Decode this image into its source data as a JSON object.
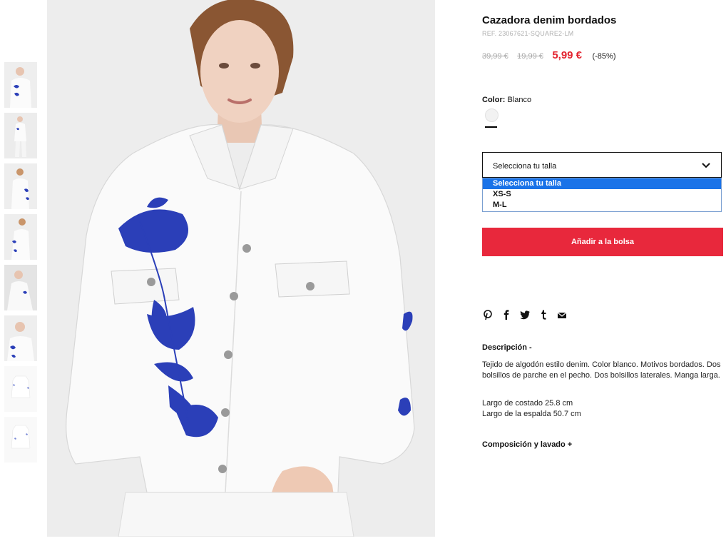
{
  "product": {
    "title": "Cazadora denim bordados",
    "ref": "REF. 23067621-SQUARE2-LM",
    "price_original": "39,99 €",
    "price_previous": "19,99 €",
    "price_current": "5,99 €",
    "discount": "(-85%)"
  },
  "color": {
    "label": "Color:",
    "value": "Blanco",
    "swatch_color": "#f2f2f2"
  },
  "size_select": {
    "label": "Selecciona tu talla",
    "options": [
      "Selecciona tu talla",
      "XS-S",
      "M-L"
    ],
    "selected_index": 0
  },
  "cart": {
    "add_label": "Añadir a la bolsa",
    "button_color": "#e8283c"
  },
  "share": {
    "icons": [
      "pinterest-icon",
      "facebook-icon",
      "twitter-icon",
      "tumblr-icon",
      "email-icon"
    ]
  },
  "description": {
    "title": "Descripción  -",
    "text": "Tejido de algodón estilo denim. Color blanco. Motivos bordados. Dos bolsillos de parche en el pecho. Dos bolsillos laterales. Manga larga.",
    "measure_1": "Largo de costado 25.8 cm",
    "measure_2": "Largo de la espalda 50.7 cm"
  },
  "composition": {
    "title": "Composición y lavado  +"
  },
  "gallery": {
    "thumbnail_count": 8,
    "embroidery_color": "#2b3fb8"
  }
}
